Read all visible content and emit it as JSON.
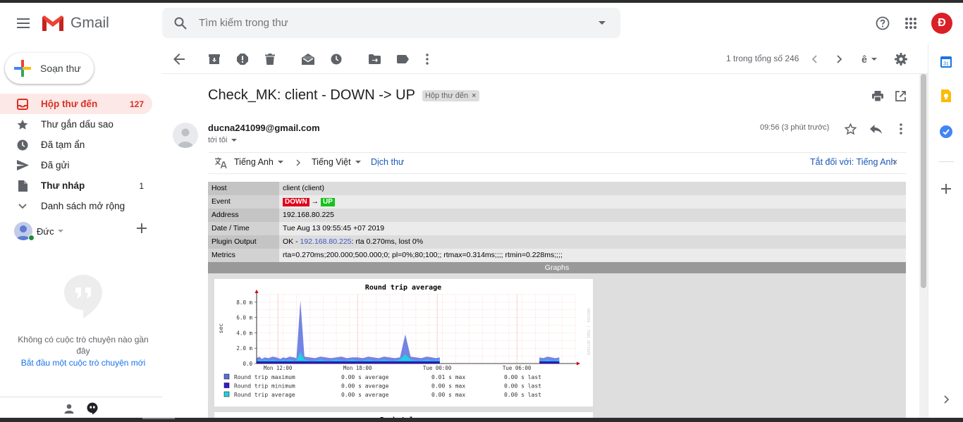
{
  "app": {
    "name": "Gmail"
  },
  "search": {
    "placeholder": "Tìm kiếm trong thư"
  },
  "header": {
    "avatar_letter": "Đ"
  },
  "sidebar": {
    "compose_label": "Soạn thư",
    "items": [
      {
        "label": "Hộp thư đến",
        "count": "127",
        "icon": "inbox-icon"
      },
      {
        "label": "Thư gắn dấu sao",
        "count": "",
        "icon": "star-icon"
      },
      {
        "label": "Đã tạm ẩn",
        "count": "",
        "icon": "clock-icon"
      },
      {
        "label": "Đã gửi",
        "count": "",
        "icon": "send-icon"
      },
      {
        "label": "Thư nháp",
        "count": "1",
        "icon": "draft-icon"
      },
      {
        "label": "Danh sách mở rộng",
        "count": "",
        "icon": "chevron-down-icon"
      }
    ],
    "hangouts_user": "Đức",
    "hangouts_empty": "Không có cuộc trò chuyện nào gần đây",
    "hangouts_start": "Bắt đầu một cuộc trò chuyện mới"
  },
  "toolbar": {
    "pager": "1 trong tổng số 246"
  },
  "message": {
    "subject": "Check_MK: client - DOWN -> UP",
    "label_chip": "Hộp thư đến",
    "label_chip_close": "×",
    "sender": "ducna241099@gmail.com",
    "to": "tới tôi",
    "time": "09:56 (3 phút trước)",
    "translate": {
      "from": "Tiếng Anh",
      "to": "Tiếng Việt",
      "action": "Dịch thư",
      "turn_off": "Tắt đối với: Tiếng Anh",
      "close": "×"
    }
  },
  "mk": {
    "rows": [
      {
        "key": "Host",
        "value": "client (client)"
      },
      {
        "key": "Event",
        "down": "DOWN",
        "arrow": "→",
        "up": "UP"
      },
      {
        "key": "Address",
        "value": "192.168.80.225"
      },
      {
        "key": "Date / Time",
        "value": "Tue Aug 13 09:55:45 +07 2019"
      },
      {
        "key": "Plugin Output",
        "prefix": "OK - ",
        "link": "192.168.80.225",
        "suffix": ": rta 0.270ms, lost 0%"
      },
      {
        "key": "Metrics",
        "value": "rta=0.270ms;200.000;500.000;0; pl=0%;80;100;; rtmax=0.314ms;;;; rtmin=0.228ms;;;;"
      }
    ],
    "graphs_header": "Graphs"
  },
  "chart_data": {
    "type": "area",
    "title": "Round trip average",
    "ylabel": "sec",
    "yticks": [
      "0.0",
      "2.0 m",
      "4.0 m",
      "6.0 m",
      "8.0 m"
    ],
    "ylim": [
      0,
      0.009
    ],
    "xticks": [
      "Mon 12:00",
      "Mon 18:00",
      "Tue 00:00",
      "Tue 06:00"
    ],
    "watermark": "RRDTOOL / TOBI OETIKER",
    "x": [
      0,
      0.2,
      0.4,
      0.6,
      0.9,
      1.2,
      1.5,
      1.8,
      2.0,
      2.2,
      2.5,
      2.8,
      3.0,
      3.3,
      3.6,
      4.0,
      4.4,
      4.8,
      5.2,
      5.6,
      6.0,
      6.4,
      6.8,
      7.2,
      7.6,
      8.0,
      8.4,
      8.8,
      9.2,
      9.6,
      10.0,
      10.4,
      10.8,
      11.2,
      11.6,
      12.0,
      12.4,
      12.8,
      13.2,
      13.5,
      13.8,
      21.3,
      21.6,
      21.9,
      22.2,
      22.5,
      22.8
    ],
    "series": [
      {
        "name": "Round trip maximum",
        "color": "#5a6ee0",
        "values": [
          0.0007,
          0.0009,
          0.0006,
          0.0008,
          0.0007,
          0.0009,
          0.0008,
          0.0006,
          0.0008,
          0.0007,
          0.0009,
          0.0008,
          0.0007,
          0.0082,
          0.0009,
          0.0008,
          0.0007,
          0.0009,
          0.0008,
          0.0007,
          0.0008,
          0.0009,
          0.0007,
          0.0008,
          0.0008,
          0.0007,
          0.0009,
          0.0008,
          0.0007,
          0.0009,
          0.0008,
          0.0007,
          0.0008,
          0.0038,
          0.0009,
          0.0008,
          0.0007,
          0.0009,
          0.0008,
          0.0007,
          0.0008,
          0.0008,
          0.0007,
          0.0009,
          0.0008,
          0.0007,
          0.0008
        ]
      },
      {
        "name": "Round trip minimum",
        "color": "#3319d6",
        "values": [
          0.0003,
          0.0003,
          0.0003,
          0.0003,
          0.0003,
          0.0003,
          0.0003,
          0.0003,
          0.0003,
          0.0003,
          0.0003,
          0.0003,
          0.0003,
          0.0003,
          0.0003,
          0.0003,
          0.0003,
          0.0003,
          0.0003,
          0.0003,
          0.0003,
          0.0003,
          0.0003,
          0.0003,
          0.0003,
          0.0003,
          0.0003,
          0.0003,
          0.0003,
          0.0003,
          0.0003,
          0.0003,
          0.0003,
          0.0003,
          0.0003,
          0.0003,
          0.0003,
          0.0003,
          0.0003,
          0.0003,
          0.0003,
          0.0003,
          0.0003,
          0.0003,
          0.0003,
          0.0003,
          0.0003
        ]
      },
      {
        "name": "Round trip average",
        "color": "#23d0e0",
        "values": [
          0.0004,
          0.0005,
          0.0004,
          0.0005,
          0.0004,
          0.0005,
          0.0004,
          0.0004,
          0.0005,
          0.0004,
          0.0005,
          0.0004,
          0.0004,
          0.0015,
          0.0005,
          0.0004,
          0.0004,
          0.0005,
          0.0004,
          0.0004,
          0.0005,
          0.0004,
          0.0004,
          0.0005,
          0.0004,
          0.0004,
          0.0005,
          0.0004,
          0.0004,
          0.0005,
          0.0004,
          0.0004,
          0.0005,
          0.0012,
          0.0005,
          0.0004,
          0.0004,
          0.0005,
          0.0004,
          0.0004,
          0.0005,
          0.0004,
          0.0004,
          0.0005,
          0.0004,
          0.0004,
          0.0005
        ]
      }
    ],
    "legend": [
      {
        "name": "Round trip maximum",
        "average": "0.00 s average",
        "max": "0.01 s max",
        "last": "0.00 s last",
        "color": "#5a6ee0"
      },
      {
        "name": "Round trip minimum",
        "average": "0.00 s average",
        "max": "0.00 s max",
        "last": "0.00 s last",
        "color": "#3319d6"
      },
      {
        "name": "Round trip average",
        "average": "0.00 s average",
        "max": "0.00 s max",
        "last": "0.00 s last",
        "color": "#23d0e0"
      }
    ],
    "next_chart_title": "Packet loss"
  }
}
